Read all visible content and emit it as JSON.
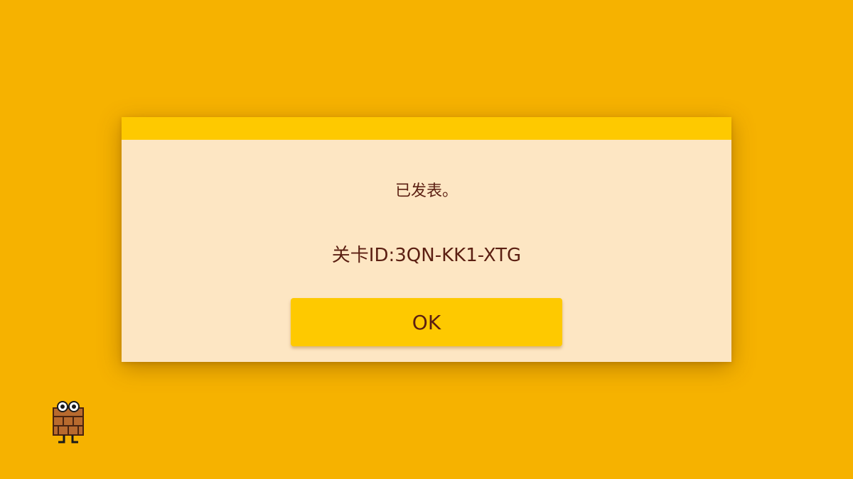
{
  "dialog": {
    "message": "已发表。",
    "level_id_label": "关卡ID",
    "level_id_separator": ":",
    "level_id_value": "3QN-KK1-XTG",
    "ok_label": "OK"
  },
  "colors": {
    "background": "#f6b200",
    "dialog_body": "#fde6c3",
    "dialog_header": "#fec900",
    "button": "#fec900",
    "text": "#5b1f12"
  },
  "icons": {
    "corner_mascot": "brick-block-mascot-icon"
  }
}
